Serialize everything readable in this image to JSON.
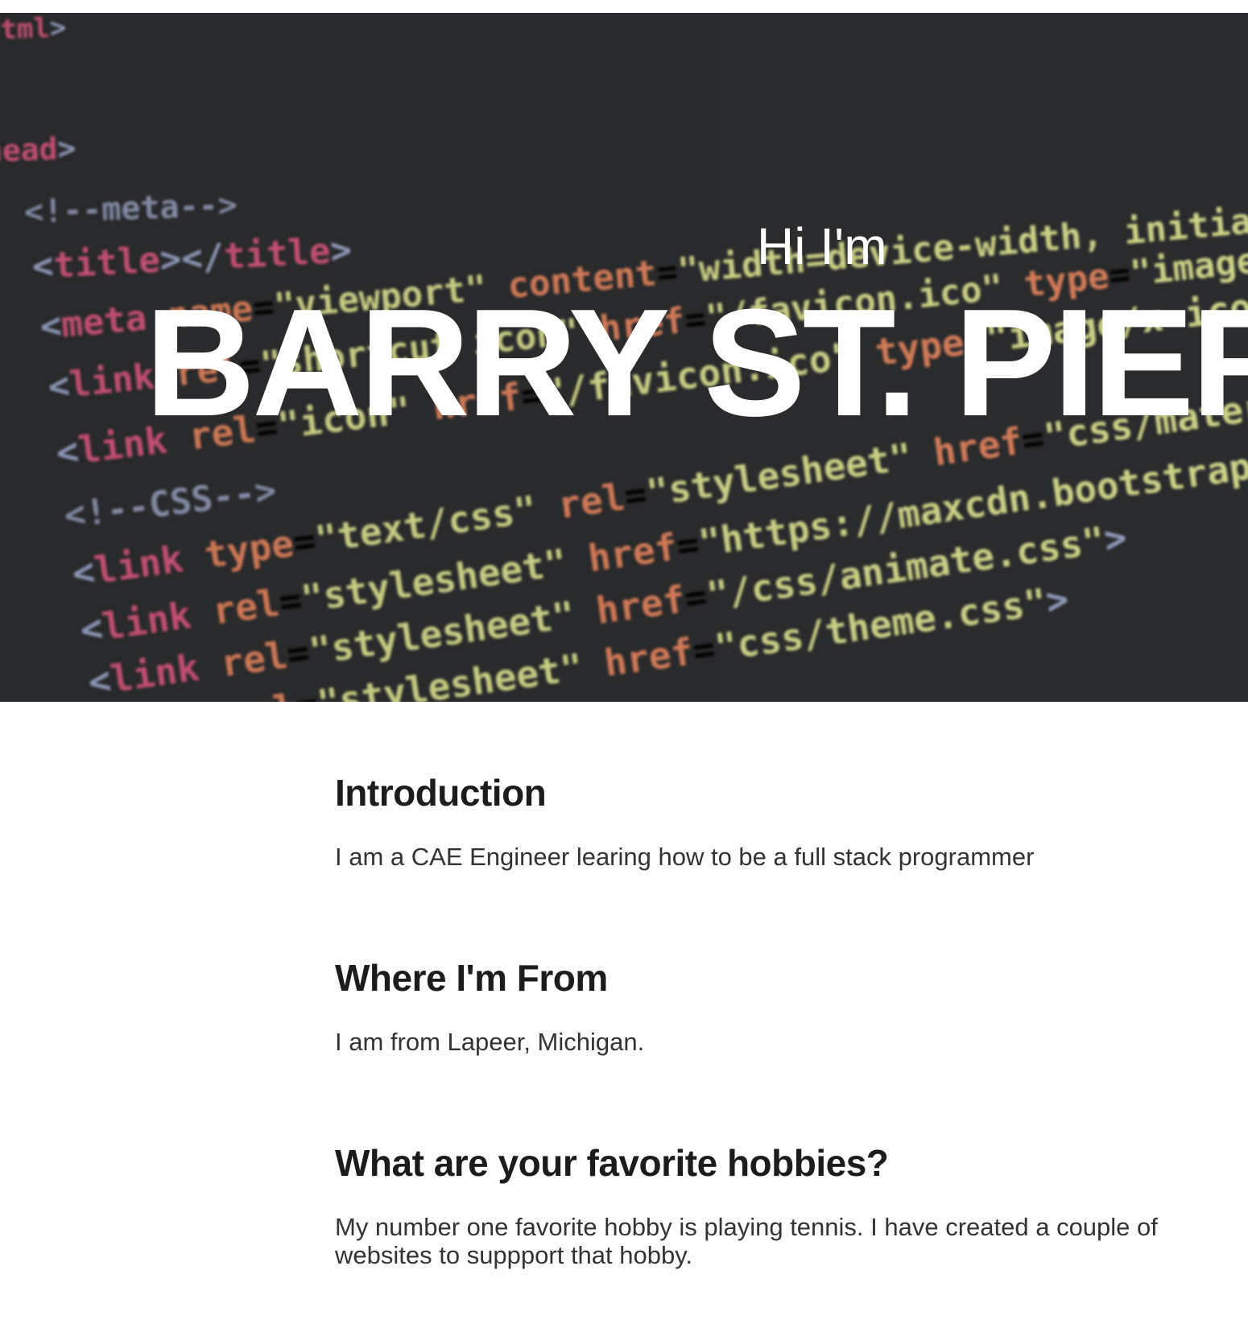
{
  "hero": {
    "greeting": "Hi I'm",
    "name": "BARRY ST. PIER",
    "background_icon": "code-screenshot-image"
  },
  "sections": [
    {
      "heading": "Introduction",
      "body": "I am a CAE Engineer learing how to be a full stack programmer"
    },
    {
      "heading": "Where I'm From",
      "body": "I am from Lapeer, Michigan."
    },
    {
      "heading": "What are your favorite hobbies?",
      "body": "My number one favorite hobby is playing tennis. I have created a couple of websites to suppport that hobby."
    }
  ],
  "colors": {
    "hero_bg": "#2b2c2e",
    "heading": "#1c1c1c",
    "body": "#333333",
    "tag": "#d4567a",
    "attr": "#e0825c",
    "string": "#d7dd8c"
  }
}
